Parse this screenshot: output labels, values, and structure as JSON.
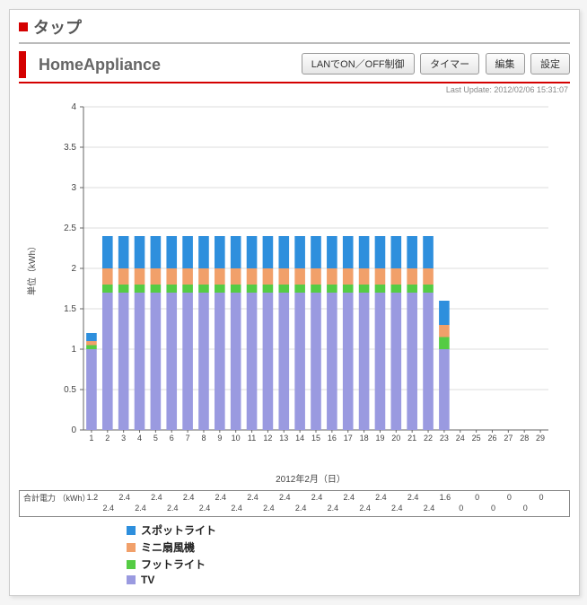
{
  "header": {
    "title": "タップ"
  },
  "subheader": {
    "title": "HomeAppliance",
    "buttons": {
      "lan": "LANでON／OFF制御",
      "timer": "タイマー",
      "edit": "編集",
      "settings": "設定"
    },
    "last_update": "Last Update: 2012/02/06 15:31:07"
  },
  "chart_data": {
    "type": "bar",
    "stacked": true,
    "title": "",
    "ylabel": "単位（kWh）",
    "xlabel": "2012年2月（日）",
    "ylim": [
      0,
      4
    ],
    "yticks": [
      0,
      0.5,
      1,
      1.5,
      2,
      2.5,
      3,
      3.5,
      4
    ],
    "categories": [
      1,
      2,
      3,
      4,
      5,
      6,
      7,
      8,
      9,
      10,
      11,
      12,
      13,
      14,
      15,
      16,
      17,
      18,
      19,
      20,
      21,
      22,
      23,
      24,
      25,
      26,
      27,
      28,
      29
    ],
    "series": [
      {
        "name": "スポットライト",
        "color": "#2e8fdd",
        "values": [
          0.1,
          0.4,
          0.4,
          0.4,
          0.4,
          0.4,
          0.4,
          0.4,
          0.4,
          0.4,
          0.4,
          0.4,
          0.4,
          0.4,
          0.4,
          0.4,
          0.4,
          0.4,
          0.4,
          0.4,
          0.4,
          0.4,
          0.3,
          0,
          0,
          0,
          0,
          0,
          0
        ]
      },
      {
        "name": "ミニ扇風機",
        "color": "#f1a06a",
        "values": [
          0.05,
          0.2,
          0.2,
          0.2,
          0.2,
          0.2,
          0.2,
          0.2,
          0.2,
          0.2,
          0.2,
          0.2,
          0.2,
          0.2,
          0.2,
          0.2,
          0.2,
          0.2,
          0.2,
          0.2,
          0.2,
          0.2,
          0.15,
          0,
          0,
          0,
          0,
          0,
          0
        ]
      },
      {
        "name": "フットライト",
        "color": "#55cc44",
        "values": [
          0.05,
          0.1,
          0.1,
          0.1,
          0.1,
          0.1,
          0.1,
          0.1,
          0.1,
          0.1,
          0.1,
          0.1,
          0.1,
          0.1,
          0.1,
          0.1,
          0.1,
          0.1,
          0.1,
          0.1,
          0.1,
          0.1,
          0.15,
          0,
          0,
          0,
          0,
          0,
          0
        ]
      },
      {
        "name": "TV",
        "color": "#9a9ae0",
        "values": [
          1.0,
          1.7,
          1.7,
          1.7,
          1.7,
          1.7,
          1.7,
          1.7,
          1.7,
          1.7,
          1.7,
          1.7,
          1.7,
          1.7,
          1.7,
          1.7,
          1.7,
          1.7,
          1.7,
          1.7,
          1.7,
          1.7,
          1.0,
          0,
          0,
          0,
          0,
          0,
          0
        ]
      }
    ],
    "totals_label": "合計電力\n（kWh）",
    "totals": [
      1.2,
      2.4,
      2.4,
      2.4,
      2.4,
      2.4,
      2.4,
      2.4,
      2.4,
      2.4,
      2.4,
      2.4,
      2.4,
      2.4,
      2.4,
      2.4,
      2.4,
      2.4,
      2.4,
      2.4,
      2.4,
      2.4,
      1.6,
      0,
      0,
      0,
      0,
      0,
      0
    ]
  }
}
